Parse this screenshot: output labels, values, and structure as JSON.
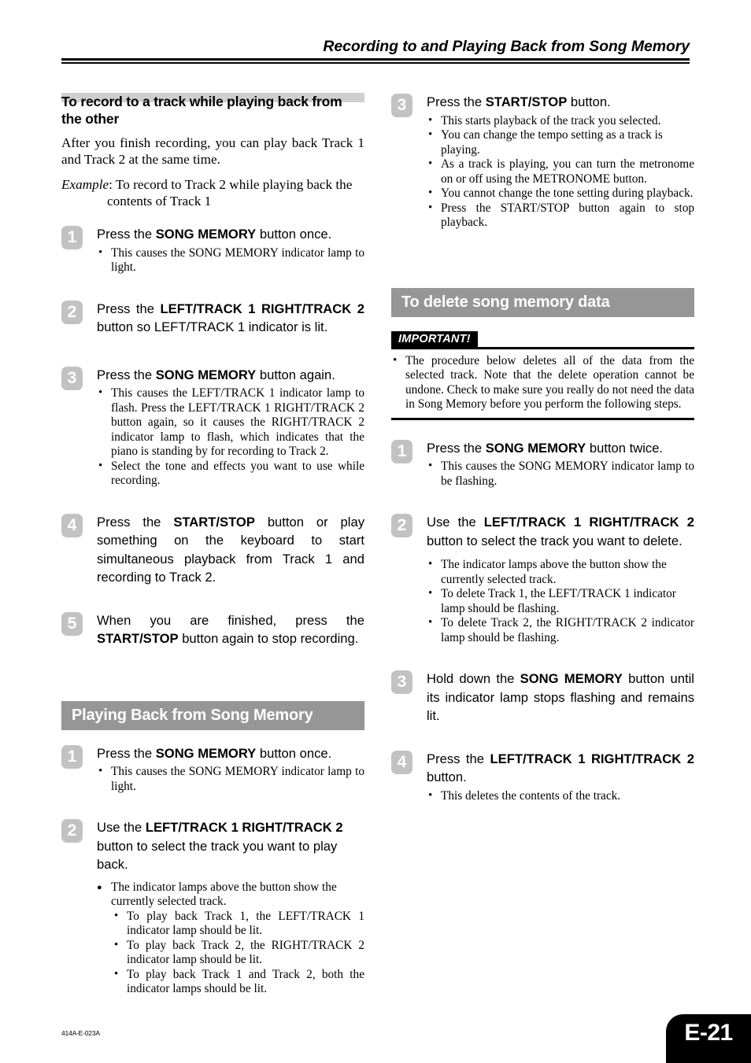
{
  "header": {
    "title": "Recording to and Playing Back from Song Memory"
  },
  "left_column": {
    "heading": "To record to a track while playing back from the other",
    "intro": "After you finish recording, you can play back Track 1 and Track 2 at the same time.",
    "example_label": "Example",
    "example_text": ": To record to Track 2 while playing back the",
    "example_cont": "contents of Track 1",
    "steps": [
      {
        "number": "1",
        "text_parts": [
          "Press the ",
          "SONG MEMORY",
          " button once."
        ],
        "bullets": [
          "This causes the SONG MEMORY indicator lamp to light."
        ]
      },
      {
        "number": "2",
        "text_parts": [
          "Press the ",
          "LEFT/TRACK 1  RIGHT/TRACK 2",
          " button so LEFT/TRACK 1 indicator is lit."
        ],
        "bullets": []
      },
      {
        "number": "3",
        "text_parts": [
          "Press the ",
          "SONG MEMORY",
          " button again."
        ],
        "bullets": [
          "This causes the LEFT/TRACK 1 indicator lamp to flash. Press the LEFT/TRACK 1  RIGHT/TRACK 2 button again, so it causes the RIGHT/TRACK 2 indicator lamp to flash, which indicates that the piano is standing by for recording to Track 2.",
          "Select the tone and effects you want to use while recording."
        ]
      },
      {
        "number": "4",
        "text_parts": [
          "Press the ",
          "START/STOP",
          " button or play something on the keyboard to start simultaneous playback from Track 1 and recording to Track 2."
        ],
        "bullets": []
      },
      {
        "number": "5",
        "text_parts": [
          "When you are finished, press the ",
          "START/STOP",
          " button again to stop recording."
        ],
        "bullets": []
      }
    ],
    "section2": {
      "heading": "Playing Back from Song Memory",
      "steps": [
        {
          "number": "1",
          "text_parts": [
            "Press the ",
            "SONG MEMORY",
            " button once."
          ],
          "bullets": [
            "This causes the SONG MEMORY indicator lamp to light."
          ]
        },
        {
          "number": "2",
          "text_parts": [
            "Use the ",
            "LEFT/TRACK 1  RIGHT/TRACK 2",
            " button to select the track you want to play back."
          ],
          "big_bullet": "The indicator lamps above the button show the currently selected track.",
          "nested_bullets": [
            "To play back Track 1, the LEFT/TRACK 1 indicator lamp should be lit.",
            "To play back Track 2, the RIGHT/TRACK 2 indicator lamp should be lit.",
            "To play back Track 1 and Track 2, both the indicator lamps should be lit."
          ]
        }
      ]
    }
  },
  "right_column": {
    "step3": {
      "number": "3",
      "text_parts": [
        "Press the ",
        "START/STOP",
        " button."
      ],
      "bullets": [
        "This starts playback of the track you selected.",
        "You can change the tempo setting as a track is playing.",
        "As a track is playing, you can turn the metronome on or off using the METRONOME button.",
        "You cannot change the tone setting during playback.",
        "Press the START/STOP button again to stop playback."
      ]
    },
    "delete_section": {
      "heading": "To delete song memory data",
      "important_label": "IMPORTANT!",
      "important_text": "The procedure below deletes all of the data from the selected track. Note that the delete operation cannot be undone. Check to make sure you really do not need the data in Song Memory before you perform the following steps.",
      "steps": [
        {
          "number": "1",
          "text_parts": [
            "Press the ",
            "SONG MEMORY",
            " button twice."
          ],
          "bullets": [
            "This causes the SONG MEMORY indicator lamp to be flashing."
          ]
        },
        {
          "number": "2",
          "text_parts": [
            "Use the ",
            "LEFT/TRACK 1  RIGHT/TRACK 2",
            " button to select the track you want to delete."
          ],
          "bullets": [
            "The indicator lamps above the button show the currently selected track.",
            "To delete Track 1, the LEFT/TRACK 1 indicator lamp should be flashing.",
            "To delete Track 2, the RIGHT/TRACK 2 indicator lamp should be flashing."
          ]
        },
        {
          "number": "3",
          "text_parts": [
            "Hold down the ",
            "SONG MEMORY",
            " button until its indicator lamp stops flashing and remains lit."
          ],
          "bullets": []
        },
        {
          "number": "4",
          "text_parts": [
            "Press the ",
            "LEFT/TRACK 1  RIGHT/TRACK 2",
            " button."
          ],
          "bullets": [
            "This deletes the contents of the track."
          ]
        }
      ]
    }
  },
  "footer": {
    "doc_code": "414A-E-023A",
    "page_number": "E-21"
  },
  "colors": {
    "band_gray": "#969696",
    "heading_band_gray": "#cfcfcf",
    "badge_gray": "#c2c2c2",
    "tab_black": "#000000"
  }
}
